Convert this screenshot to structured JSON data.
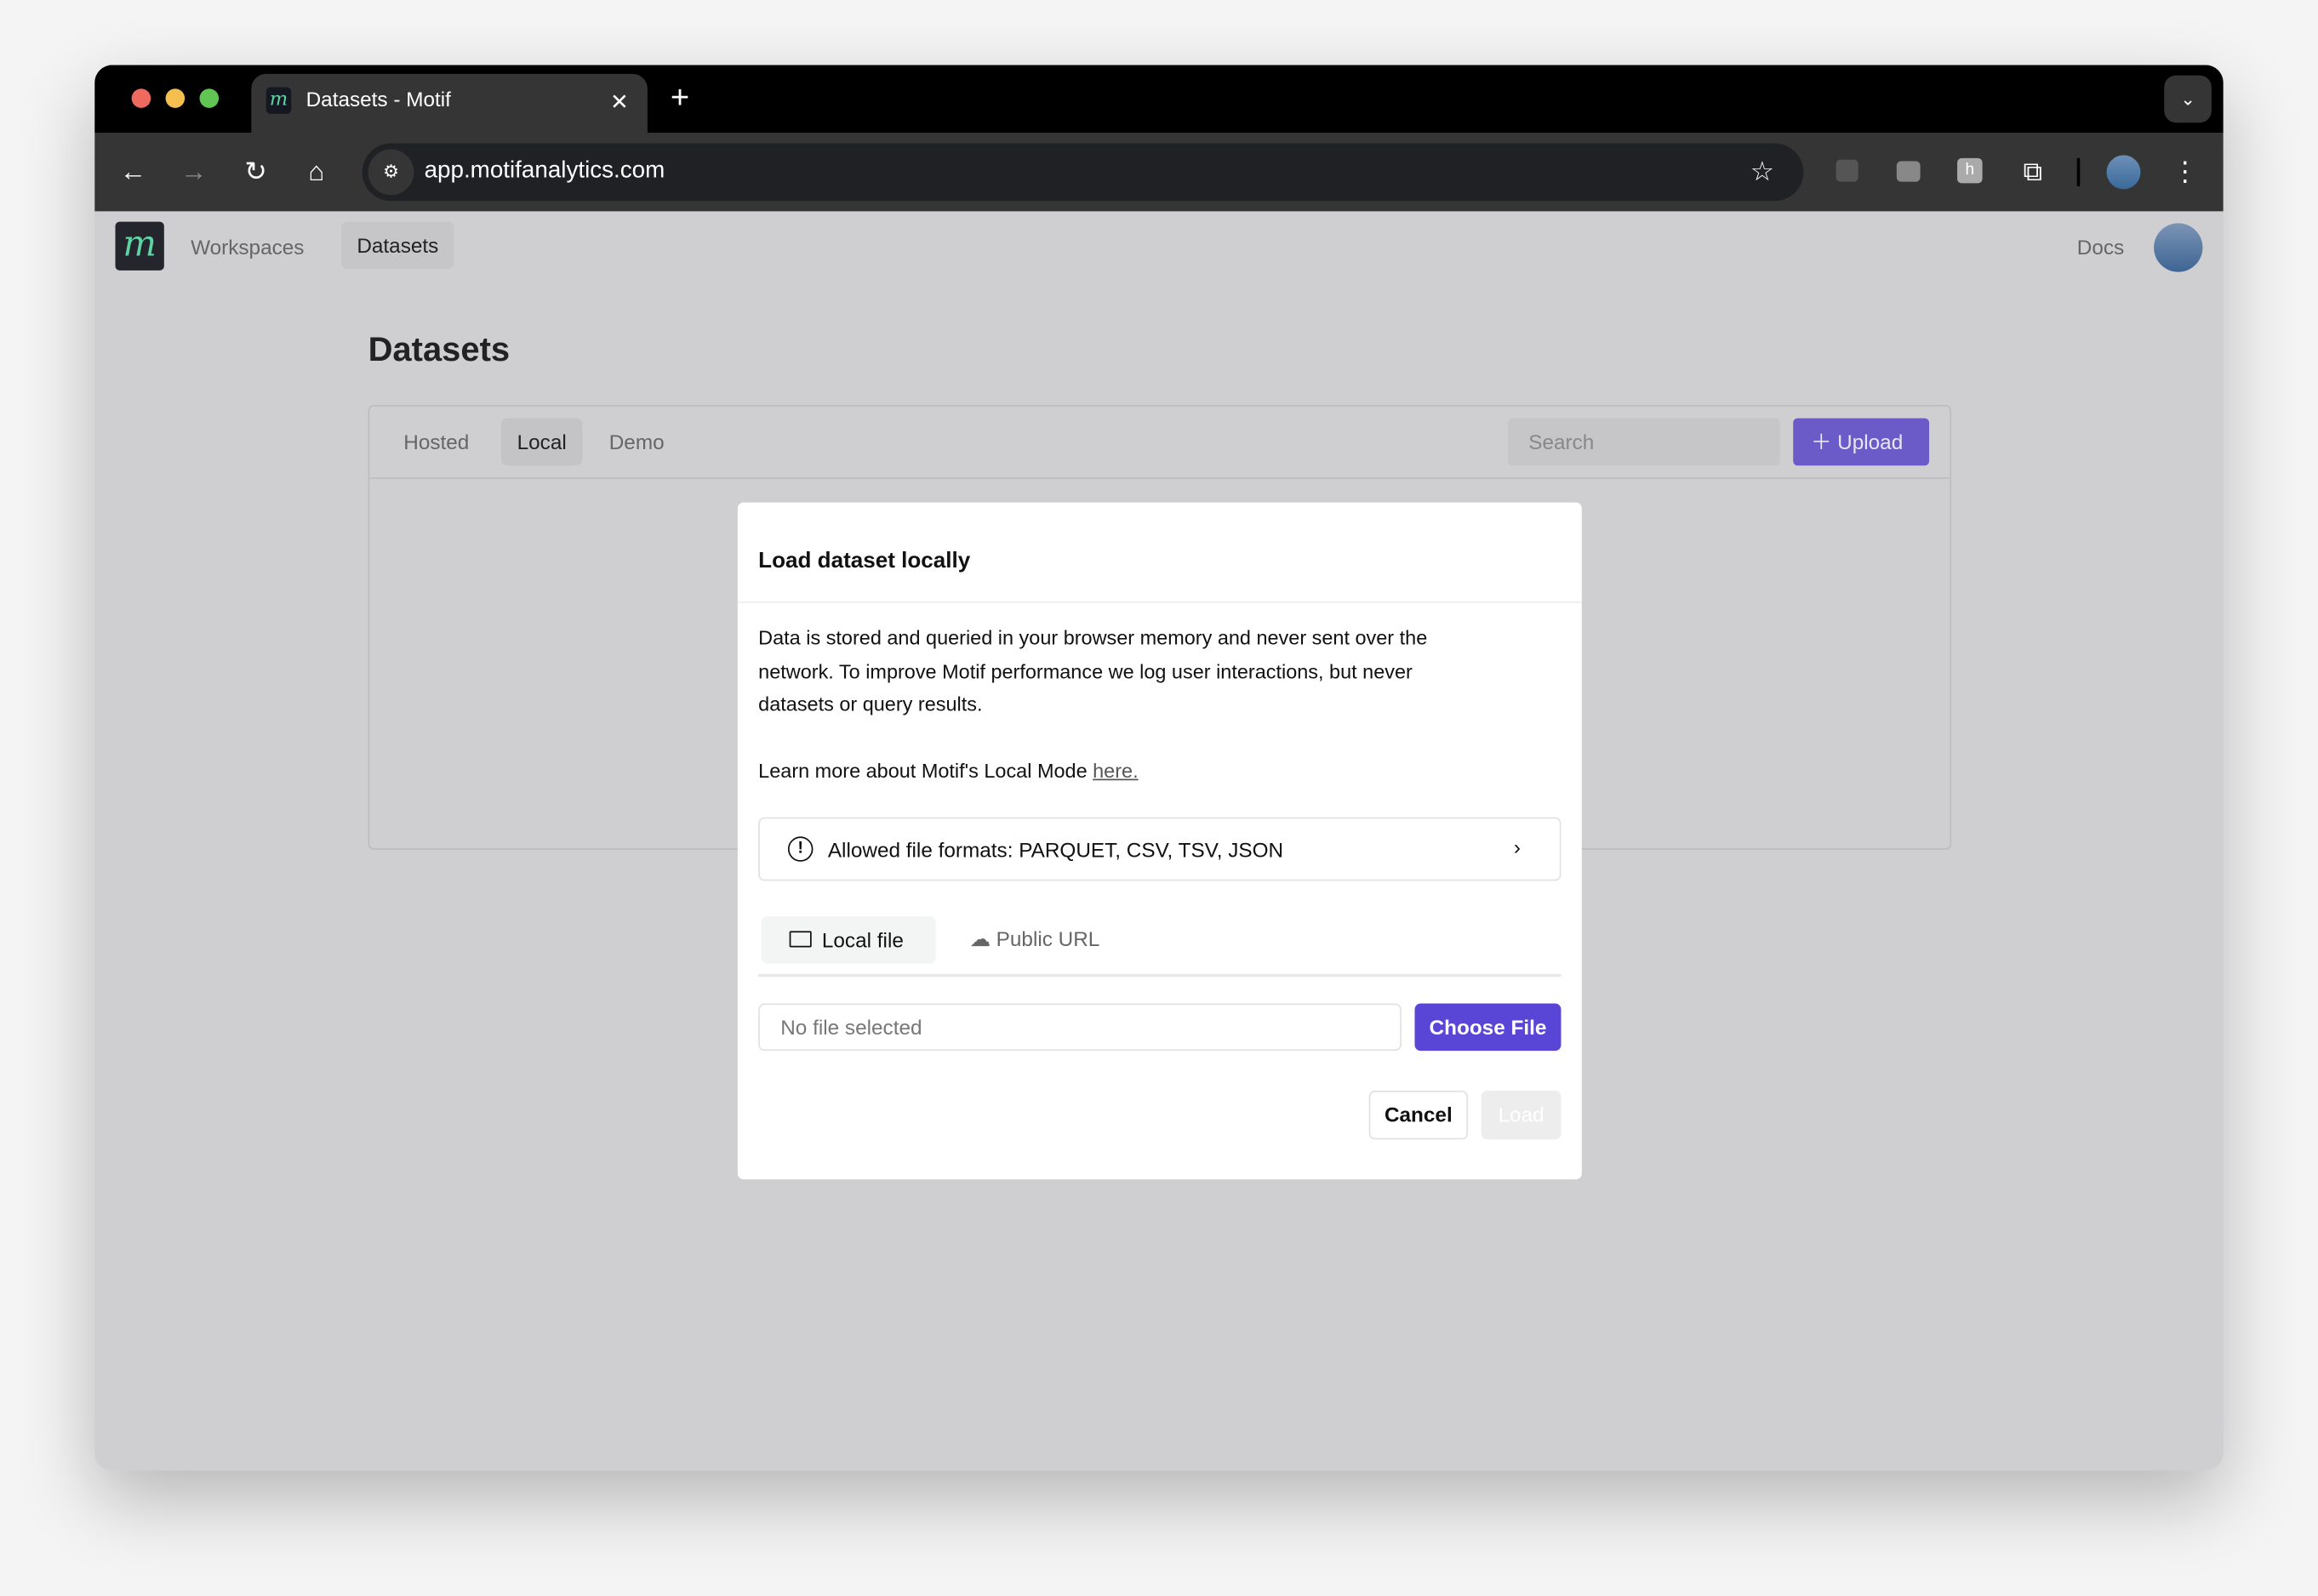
{
  "browser": {
    "tab_title": "Datasets - Motif",
    "url": "app.motifanalytics.com",
    "icons": [
      "back-icon",
      "forward-icon",
      "reload-icon",
      "home-icon",
      "site-settings-icon",
      "star-icon",
      "extension-icons",
      "puzzle-icon",
      "profile-avatar",
      "kebab-menu-icon"
    ]
  },
  "nav": {
    "logo": "m",
    "items": [
      "Workspaces",
      "Datasets"
    ],
    "docs": "Docs"
  },
  "page": {
    "title": "Datasets",
    "tabs": [
      "Hosted",
      "Local",
      "Demo"
    ],
    "active_tab": "Local",
    "search_placeholder": "Search",
    "upload": "Upload"
  },
  "modal": {
    "title": "Load dataset locally",
    "body1": "Data is stored and queried in your browser memory and never sent over the",
    "body2": "network. To improve Motif performance we log user interactions, but never",
    "body3": "datasets or query results.",
    "learn_more": "Learn more about Motif's Local Mode ",
    "learn_link": "here.",
    "formats": "Allowed file formats: PARQUET, CSV, TSV, JSON",
    "tabs": [
      "Local file",
      "Public URL"
    ],
    "active_tab": "Local file",
    "file_placeholder": "No file selected",
    "choose": "Choose File",
    "cancel": "Cancel",
    "load": "Load"
  },
  "colors": {
    "accent": "#5a46d6",
    "overlay": "#cfcfd1"
  }
}
